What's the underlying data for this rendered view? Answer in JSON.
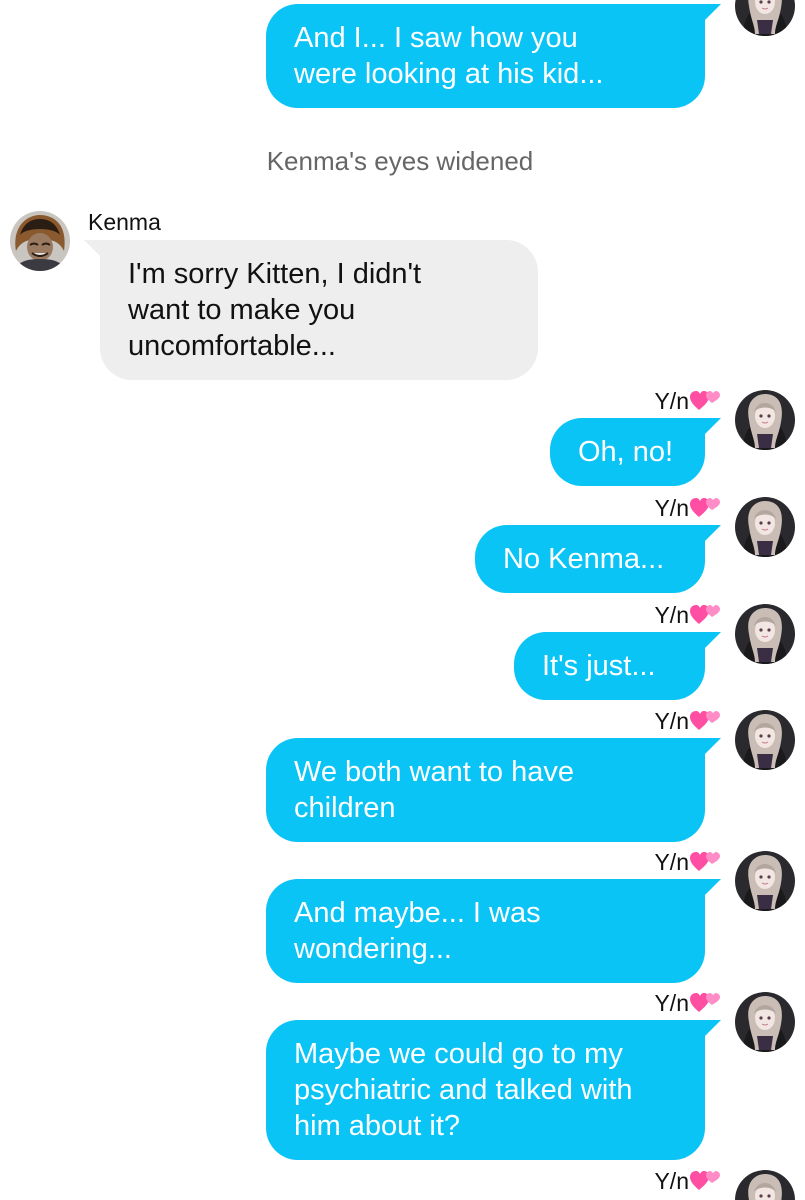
{
  "narration": "Kenma's eyes widened",
  "kenma": {
    "name": "Kenma"
  },
  "yn": {
    "name": "Y/n"
  },
  "messages": {
    "m0": "And I... I saw how you\nwere looking at his kid...",
    "m1": "I'm sorry Kitten, I didn't\nwant to make you\nuncomfortable...",
    "m2": "Oh, no!",
    "m3": "No Kenma...",
    "m4": "It's just...",
    "m5": "We both want to have\nchildren",
    "m6": "And maybe... I was\nwondering...",
    "m7": "Maybe we could go to my\npsychiatric and talked with\nhim about it?"
  },
  "colors": {
    "outgoing_bubble": "#0bc4f6",
    "incoming_bubble": "#eeeeee",
    "narration_text": "#666666",
    "heart": "#ff4fa3"
  },
  "icons": {
    "yn_name_suffix": "two-hearts-icon",
    "yn_avatar": "avatar-yn-icon",
    "kenma_avatar": "avatar-kenma-icon"
  }
}
